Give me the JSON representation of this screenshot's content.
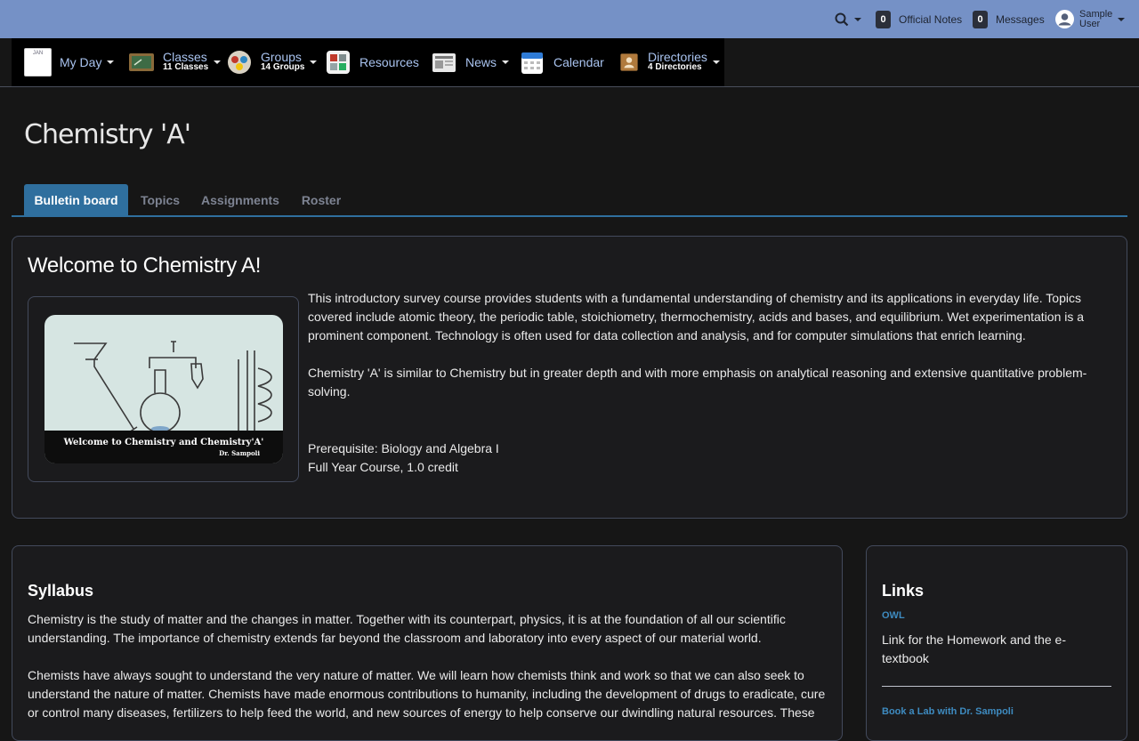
{
  "topbar": {
    "official_notes": {
      "count": "0",
      "label": "Official Notes"
    },
    "messages": {
      "count": "0",
      "label": "Messages"
    },
    "user": {
      "line1": "Sample",
      "line2": "User"
    }
  },
  "nav": {
    "myday": {
      "label": "My Day",
      "icon_text": "JAN"
    },
    "classes": {
      "label": "Classes",
      "sub": "11 Classes"
    },
    "groups": {
      "label": "Groups",
      "sub": "14 Groups"
    },
    "resources": {
      "label": "Resources"
    },
    "news": {
      "label": "News"
    },
    "calendar": {
      "label": "Calendar"
    },
    "directories": {
      "label": "Directories",
      "sub": "4 Directories"
    }
  },
  "page": {
    "title": "Chemistry 'A'"
  },
  "tabs": [
    {
      "label": "Bulletin board"
    },
    {
      "label": "Topics"
    },
    {
      "label": "Assignments"
    },
    {
      "label": "Roster"
    }
  ],
  "welcome": {
    "title": "Welcome to Chemistry A!",
    "banner_text": "Welcome to Chemistry and Chemistry'A'",
    "banner_sig": "Dr. Sampoli",
    "para1": "This introductory survey course provides students with a fundamental understanding of chemistry and its applications in everyday life. Topics covered include atomic theory, the periodic table, stoichiometry, thermochemistry, acids and bases, and equilibrium. Wet experimentation is a prominent component. Technology is often used for data collection and analysis, and for computer simulations that enrich learning.",
    "para2": "Chemistry 'A'  is similar to Chemistry but in greater depth and with more emphasis on analytical reasoning and extensive quantitative problem-solving.",
    "prereq": "Prerequisite: Biology and Algebra I",
    "credit": "Full Year Course, 1.0 credit"
  },
  "syllabus": {
    "title": "Syllabus",
    "para1": "Chemistry is the study of matter and the changes in matter.  Together with its counterpart, physics, it is at the foundation of all our scientific understanding.  The importance of chemistry extends far beyond the classroom and laboratory into every aspect of our material world.",
    "para2": "Chemists have always sought to understand the very nature of matter. We will learn how chemists think and work so that we can also seek to understand the nature of matter.  Chemists have made enormous contributions to humanity, including the development of drugs to eradicate, cure or control many diseases, fertilizers to help feed the world, and new sources of energy to help conserve our dwindling natural resources.  These"
  },
  "links": {
    "title": "Links",
    "items": [
      {
        "title": "OWL",
        "desc": "Link for the Homework and the e-textbook"
      },
      {
        "title": "Book a Lab with Dr. Sampoli"
      }
    ]
  }
}
